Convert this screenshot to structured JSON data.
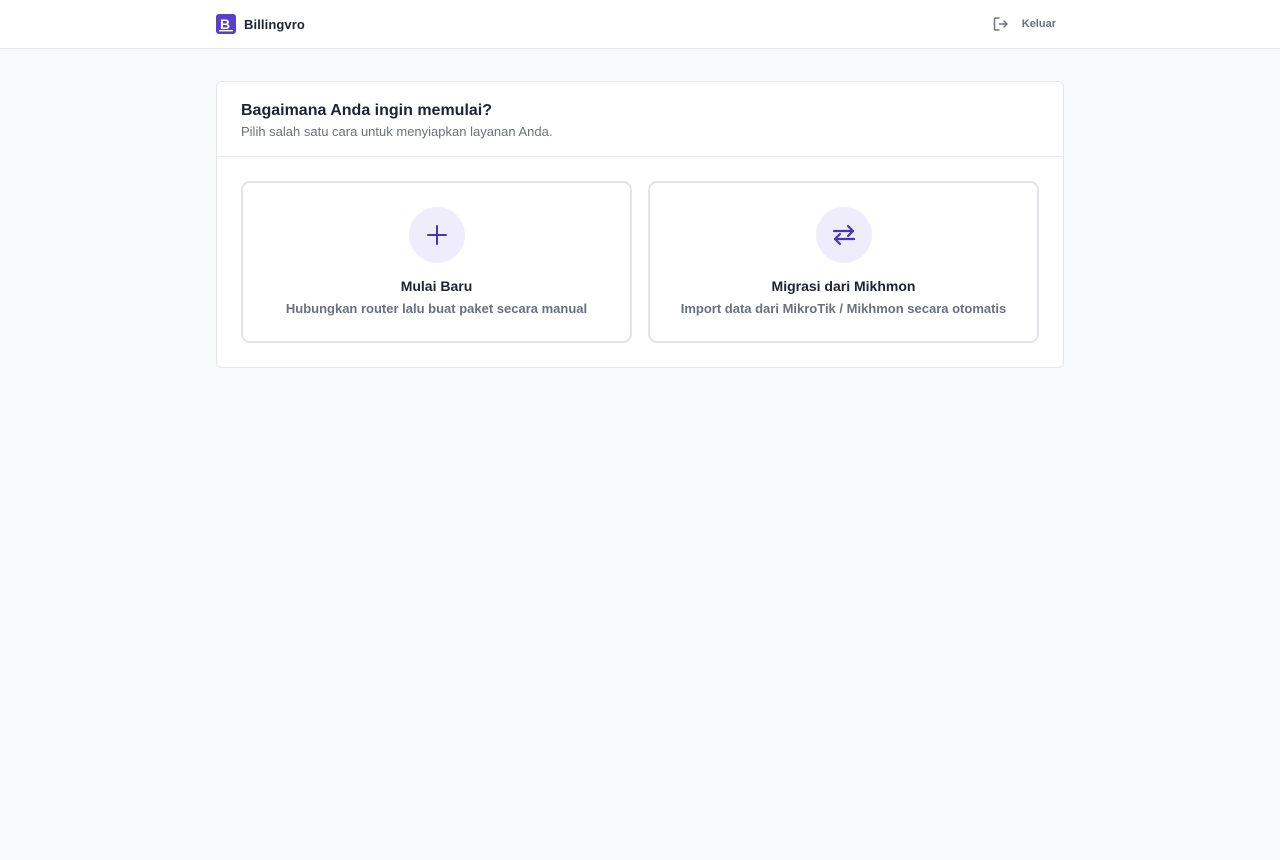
{
  "header": {
    "brand_name": "Billingvro",
    "logo_icon": "billingvro-logo-icon",
    "logout_label": "Keluar",
    "logout_icon": "logout-icon"
  },
  "onboarding": {
    "title": "Bagaimana Anda ingin memulai?",
    "subtitle": "Pilih salah satu cara untuk menyiapkan layanan Anda.",
    "options": [
      {
        "title": "Mulai Baru",
        "description": "Hubungkan router lalu buat paket secara manual",
        "icon": "plus-icon"
      },
      {
        "title": "Migrasi dari Mikhmon",
        "description": "Import data dari MikroTik / Mikhmon secara otomatis",
        "icon": "swap-arrows-icon"
      }
    ]
  },
  "colors": {
    "accent": "#5a40c8",
    "icon_bg": "#efedfb",
    "page_bg": "#f8f9fb",
    "border": "#e6e8ee",
    "text_primary": "#1f2330",
    "text_muted": "#6b7080"
  }
}
